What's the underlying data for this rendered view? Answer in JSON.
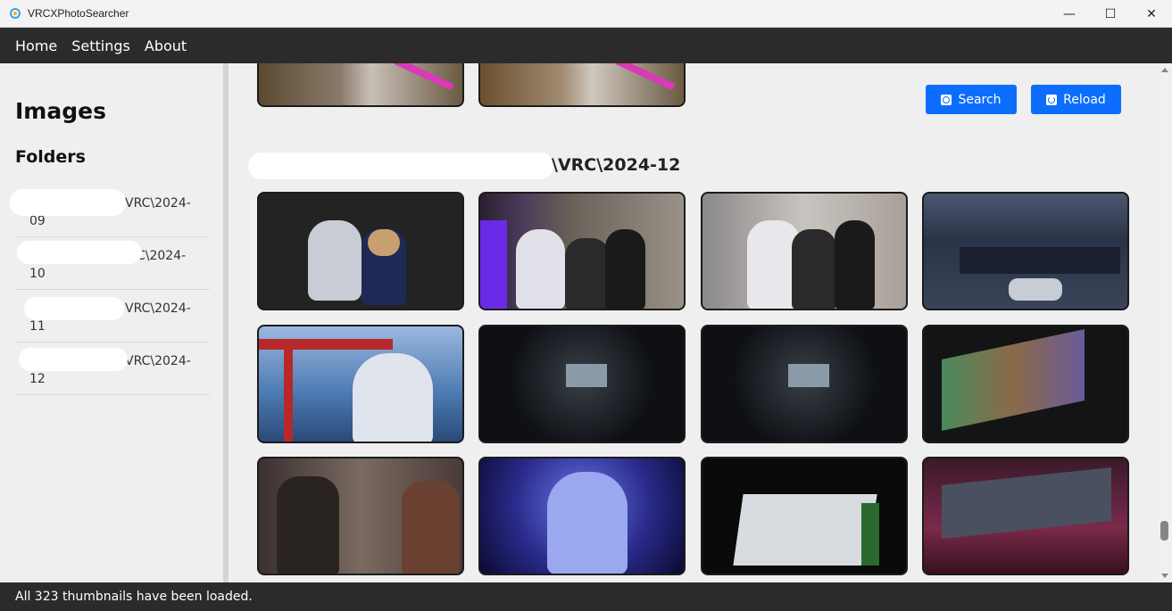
{
  "window": {
    "title": "VRCXPhotoSearcher",
    "minimize": "—",
    "maximize": "☐",
    "close": "✕"
  },
  "menu": [
    "Home",
    "Settings",
    "About"
  ],
  "sidebar": {
    "images_title": "Images",
    "folders_title": "Folders",
    "folders": [
      {
        "line1": "VRC\\2024-",
        "line2": "09"
      },
      {
        "line1": "C\\2024-",
        "line2": "10"
      },
      {
        "line1": "VRC\\2024-",
        "line2": "11"
      },
      {
        "line1": "VRC\\2024-",
        "line2": "12"
      }
    ]
  },
  "toolbar": {
    "search_label": "Search",
    "reload_label": "Reload"
  },
  "section": {
    "title": "\\VRC\\2024-12"
  },
  "status": {
    "text": "All 323 thumbnails have been loaded."
  },
  "colors": {
    "accent": "#0d6efd",
    "chrome": "#2b2b2b",
    "panel": "#efefef"
  }
}
